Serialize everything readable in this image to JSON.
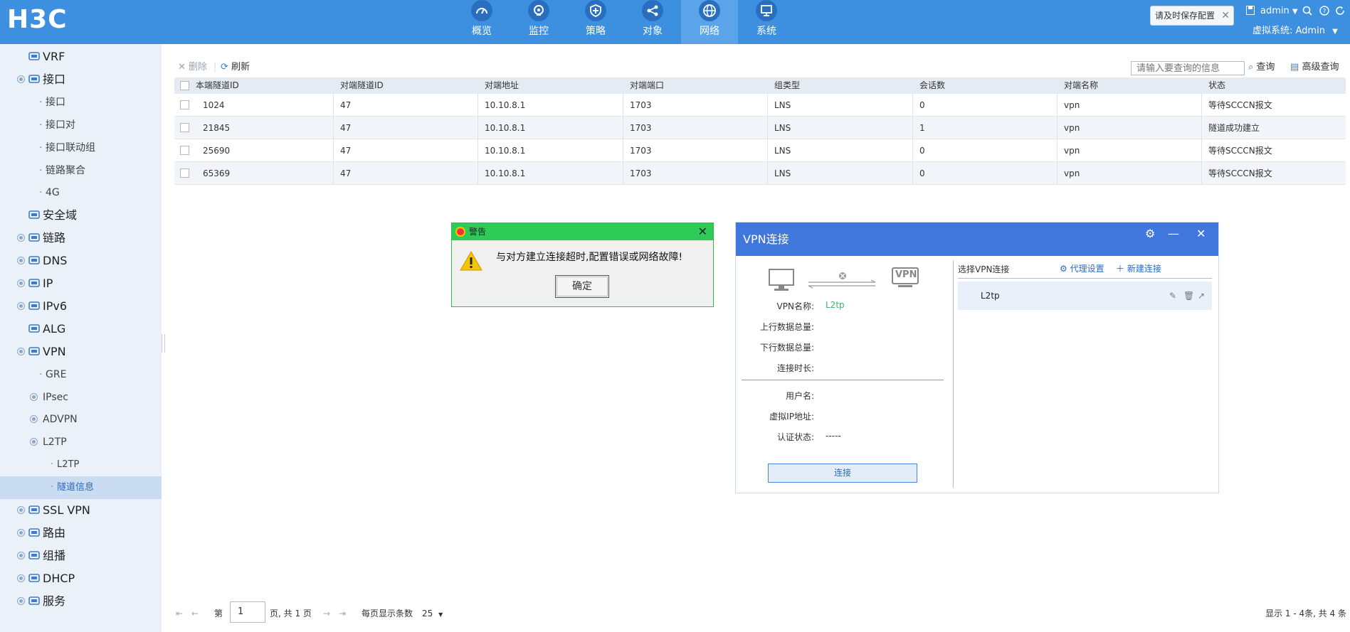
{
  "app": {
    "logo": "H3C"
  },
  "nav": [
    {
      "label": "概览",
      "icon": "gauge-icon"
    },
    {
      "label": "监控",
      "icon": "camera-icon"
    },
    {
      "label": "策略",
      "icon": "shield-icon"
    },
    {
      "label": "对象",
      "icon": "share-icon"
    },
    {
      "label": "网络",
      "icon": "globe-icon",
      "active": true
    },
    {
      "label": "系统",
      "icon": "monitor-icon"
    }
  ],
  "header": {
    "save_tip": "请及时保存配置",
    "user": "admin",
    "vsys_label": "虚拟系统: Admin"
  },
  "sidebar": [
    {
      "label": "VRF",
      "level": 1,
      "icon": "vrf-icon"
    },
    {
      "label": "接口",
      "level": 1,
      "icon": "interface-icon",
      "expander": true
    },
    {
      "label": "接口",
      "level": 2
    },
    {
      "label": "接口对",
      "level": 2
    },
    {
      "label": "接口联动组",
      "level": 2
    },
    {
      "label": "链路聚合",
      "level": 2
    },
    {
      "label": "4G",
      "level": 2
    },
    {
      "label": "安全域",
      "level": 1,
      "icon": "security-zone-icon"
    },
    {
      "label": "链路",
      "level": 1,
      "icon": "link-icon",
      "expander": true
    },
    {
      "label": "DNS",
      "level": 1,
      "icon": "dns-icon",
      "expander": true
    },
    {
      "label": "IP",
      "level": 1,
      "icon": "ip-icon",
      "expander": true
    },
    {
      "label": "IPv6",
      "level": 1,
      "icon": "ipv6-icon",
      "expander": true
    },
    {
      "label": "ALG",
      "level": 1,
      "icon": "alg-icon"
    },
    {
      "label": "VPN",
      "level": 1,
      "icon": "vpn-icon",
      "expander": true
    },
    {
      "label": "GRE",
      "level": 2
    },
    {
      "label": "IPsec",
      "level": 2,
      "expander": true
    },
    {
      "label": "ADVPN",
      "level": 2,
      "expander": true
    },
    {
      "label": "L2TP",
      "level": 2,
      "expander": true
    },
    {
      "label": "L2TP",
      "level": 3
    },
    {
      "label": "隧道信息",
      "level": 3,
      "selected": true
    },
    {
      "label": "SSL VPN",
      "level": 1,
      "icon": "ssl-vpn-icon",
      "expander": true
    },
    {
      "label": "路由",
      "level": 1,
      "icon": "route-icon",
      "expander": true
    },
    {
      "label": "组播",
      "level": 1,
      "icon": "multicast-icon",
      "expander": true
    },
    {
      "label": "DHCP",
      "level": 1,
      "icon": "dhcp-icon",
      "expander": true
    },
    {
      "label": "服务",
      "level": 1,
      "icon": "service-icon",
      "expander": true
    }
  ],
  "toolbar": {
    "delete": "删除",
    "refresh": "刷新",
    "search_placeholder": "请输入要查询的信息",
    "search": "查询",
    "advanced_search": "高级查询"
  },
  "table": {
    "columns": [
      "本端隧道ID",
      "对端隧道ID",
      "对端地址",
      "对端端口",
      "组类型",
      "会话数",
      "对端名称",
      "状态"
    ],
    "rows": [
      [
        "1024",
        "47",
        "10.10.8.1",
        "1703",
        "LNS",
        "0",
        "vpn",
        "等待SCCCN报文"
      ],
      [
        "21845",
        "47",
        "10.10.8.1",
        "1703",
        "LNS",
        "1",
        "vpn",
        "隧道成功建立"
      ],
      [
        "25690",
        "47",
        "10.10.8.1",
        "1703",
        "LNS",
        "0",
        "vpn",
        "等待SCCCN报文"
      ],
      [
        "65369",
        "47",
        "10.10.8.1",
        "1703",
        "LNS",
        "0",
        "vpn",
        "等待SCCCN报文"
      ]
    ]
  },
  "pager": {
    "page_prefix": "第",
    "page_value": "1",
    "page_suffix": "页, 共 1 页",
    "per_page_label": "每页显示条数",
    "per_page_value": "25",
    "summary": "显示 1 - 4条, 共 4 条"
  },
  "alert": {
    "title": "警告",
    "message": "与对方建立连接超时,配置错误或网络故障!",
    "ok": "确定"
  },
  "vpn_panel": {
    "title": "VPN连接",
    "vpn_badge": "VPN",
    "fields": [
      {
        "label": "VPN名称:",
        "value": "L2tp"
      },
      {
        "label": "上行数据总量:",
        "value": ""
      },
      {
        "label": "下行数据总量:",
        "value": ""
      },
      {
        "label": "连接时长:",
        "value": ""
      }
    ],
    "fields2": [
      {
        "label": "用户名:",
        "value": ""
      },
      {
        "label": "虚拟IP地址:",
        "value": ""
      },
      {
        "label": "认证状态:",
        "value": "-----"
      }
    ],
    "connect": "连接",
    "select_label": "选择VPN连接",
    "proxy": "代理设置",
    "new_connection": "新建连接",
    "connections": [
      "L2tp"
    ]
  }
}
